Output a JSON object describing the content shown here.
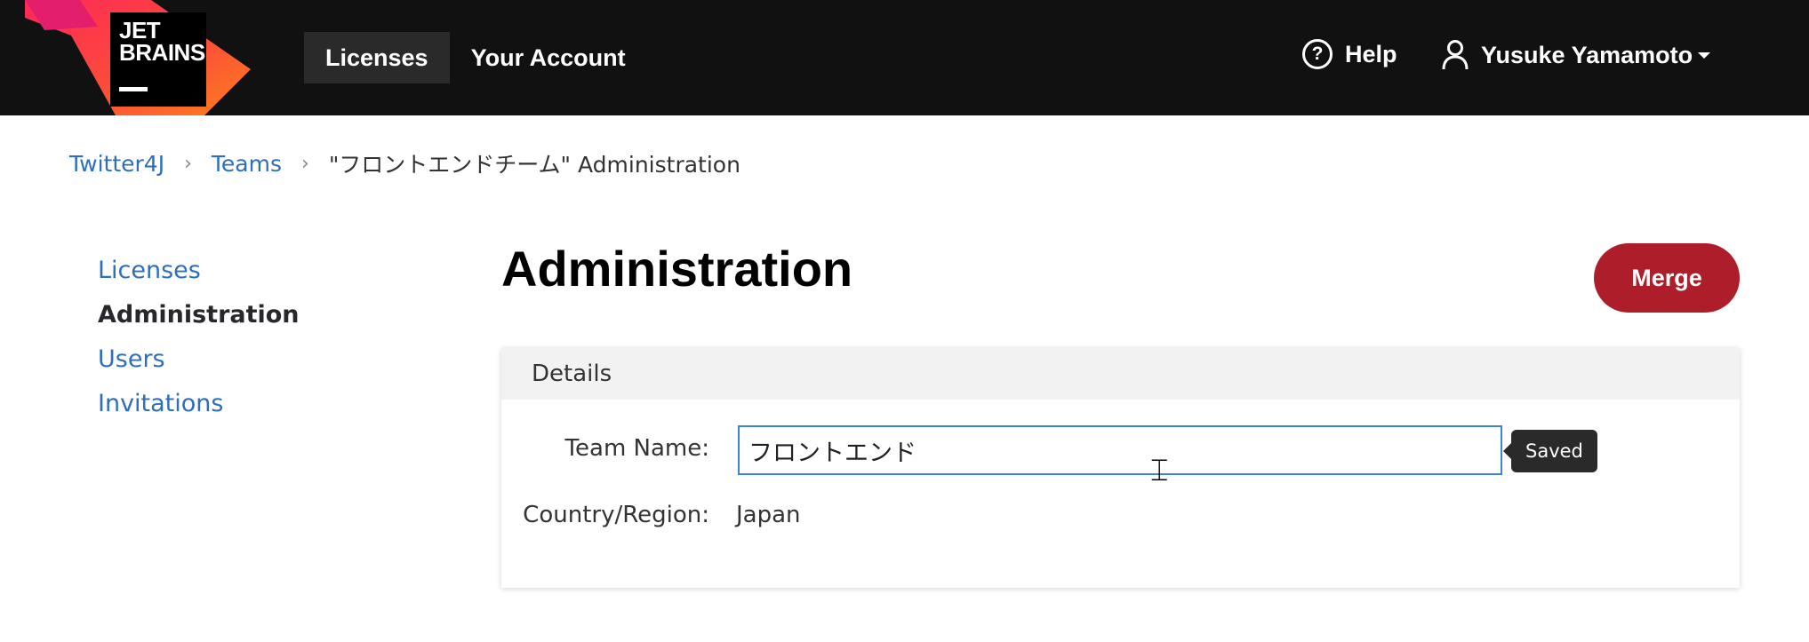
{
  "logo": {
    "line1": "JET",
    "line2": "BRAINS",
    "colors": [
      "#fe2857",
      "#fc801d",
      "#000000"
    ]
  },
  "topnav": {
    "items": [
      {
        "label": "Licenses",
        "active": true
      },
      {
        "label": "Your Account",
        "active": false
      }
    ],
    "help_label": "Help",
    "help_icon": "question-circle-icon",
    "user_icon": "user-icon",
    "user_name": "Yusuke Yamamoto"
  },
  "breadcrumb": {
    "items": [
      "Twitter4J",
      "Teams"
    ],
    "current": "\"フロントエンドチーム\" Administration",
    "separator": ">"
  },
  "sidebar": {
    "items": [
      {
        "label": "Licenses",
        "active": false
      },
      {
        "label": "Administration",
        "active": true
      },
      {
        "label": "Users",
        "active": false
      },
      {
        "label": "Invitations",
        "active": false
      }
    ]
  },
  "main": {
    "title": "Administration",
    "merge_label": "Merge",
    "details": {
      "header": "Details",
      "team_name_label": "Team Name:",
      "team_name_value": "フロントエンド",
      "saved_tooltip": "Saved",
      "country_label": "Country/Region:",
      "country_value": "Japan"
    }
  },
  "colors": {
    "topbar": "#111111",
    "link": "#2d6fbd",
    "merge_button": "#ad1d2a",
    "input_focus": "#3b84d6"
  }
}
